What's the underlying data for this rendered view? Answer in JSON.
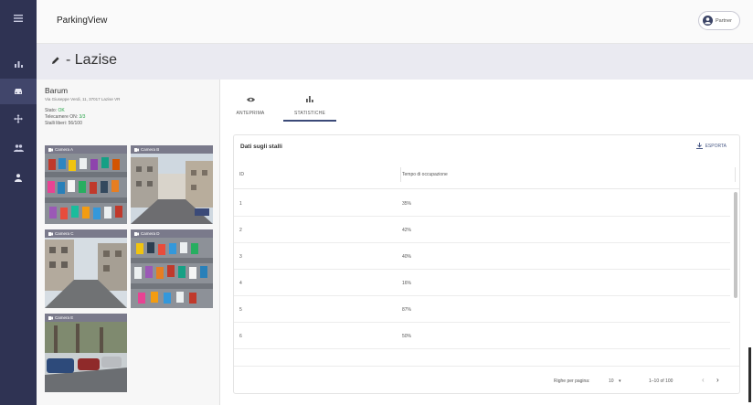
{
  "app": {
    "name": "ParkingView"
  },
  "header": {
    "partner_label": "Partner"
  },
  "sidebar": {
    "items": [
      {
        "icon": "menu-icon"
      },
      {
        "icon": "chart-icon"
      },
      {
        "icon": "car-icon",
        "active": true
      },
      {
        "icon": "move-icon"
      },
      {
        "icon": "group-icon"
      },
      {
        "icon": "user-icon"
      }
    ]
  },
  "page": {
    "title": "- Lazise"
  },
  "parking": {
    "name": "Barum",
    "address": "Via Giuseppe Verdi, 11, 37017 Lazise VR",
    "status_label": "Stato:",
    "status_value": "OK",
    "cameras_label": "Telecamere ON:",
    "cameras_value": "3/3",
    "free_label": "Stalli liberi:",
    "free_value": "56/100"
  },
  "cameras": [
    {
      "label": "Camera A"
    },
    {
      "label": "Camera B"
    },
    {
      "label": "Camera C"
    },
    {
      "label": "Camera D"
    },
    {
      "label": "Camera E"
    }
  ],
  "tabs": [
    {
      "label": "ANTEPRIMA",
      "icon": "eye-icon"
    },
    {
      "label": "STATISTICHE",
      "icon": "bar-chart-icon",
      "active": true
    }
  ],
  "table": {
    "title": "Dati sugli stalli",
    "export_label": "ESPORTA",
    "columns": [
      "ID",
      "Tempo di occupazione"
    ],
    "rows": [
      {
        "id": "1",
        "value": "35%"
      },
      {
        "id": "2",
        "value": "42%"
      },
      {
        "id": "3",
        "value": "40%"
      },
      {
        "id": "4",
        "value": "16%"
      },
      {
        "id": "5",
        "value": "87%"
      },
      {
        "id": "6",
        "value": "50%"
      }
    ],
    "rows_per_page_label": "Righe per pagina:",
    "rows_per_page_value": "10",
    "range_label": "1–10 of 100"
  }
}
